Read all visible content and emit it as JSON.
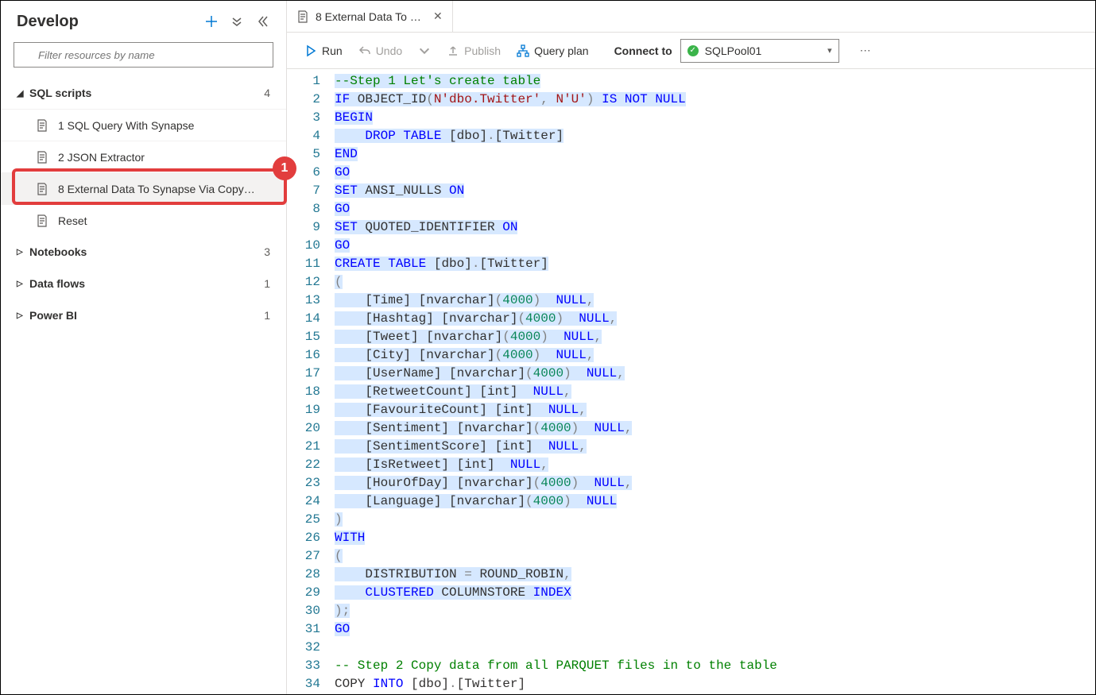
{
  "sidebar": {
    "title": "Develop",
    "filter_placeholder": "Filter resources by name",
    "groups": [
      {
        "key": "sql",
        "label": "SQL scripts",
        "expanded": true,
        "count": "4",
        "items": [
          {
            "label": "1 SQL Query With Synapse"
          },
          {
            "label": "2 JSON Extractor"
          },
          {
            "label": "8 External Data To Synapse Via Copy…",
            "active": true
          },
          {
            "label": "Reset"
          }
        ]
      },
      {
        "key": "notebooks",
        "label": "Notebooks",
        "expanded": false,
        "count": "3",
        "items": []
      },
      {
        "key": "dataflows",
        "label": "Data flows",
        "expanded": false,
        "count": "1",
        "items": []
      },
      {
        "key": "powerbi",
        "label": "Power BI",
        "expanded": false,
        "count": "1",
        "items": []
      }
    ]
  },
  "callout_badge": "1",
  "tab": {
    "label": "8 External Data To Sy…"
  },
  "toolbar": {
    "run": "Run",
    "undo": "Undo",
    "publish": "Publish",
    "queryplan": "Query plan",
    "connect_label": "Connect to",
    "connect_value": "SQLPool01"
  },
  "editor": {
    "lines": [
      {
        "n": 1,
        "sel": true,
        "tokens": [
          [
            "--Step 1 Let's create table",
            "comment"
          ]
        ]
      },
      {
        "n": 2,
        "sel": true,
        "tokens": [
          [
            "IF",
            "kw"
          ],
          [
            " OBJECT_ID",
            ""
          ],
          [
            "(",
            "gray"
          ],
          [
            "N'dbo.Twitter'",
            "str"
          ],
          [
            ",",
            "gray"
          ],
          [
            " ",
            ""
          ],
          [
            "N'U'",
            "str"
          ],
          [
            ")",
            "gray"
          ],
          [
            " ",
            ""
          ],
          [
            "IS",
            "kw"
          ],
          [
            " ",
            ""
          ],
          [
            "NOT",
            "kw"
          ],
          [
            " ",
            ""
          ],
          [
            "NULL",
            "kw"
          ]
        ]
      },
      {
        "n": 3,
        "sel": true,
        "tokens": [
          [
            "BEGIN",
            "kw"
          ]
        ]
      },
      {
        "n": 4,
        "sel": true,
        "tokens": [
          [
            "    ",
            ""
          ],
          [
            "DROP",
            "kw"
          ],
          [
            " ",
            ""
          ],
          [
            "TABLE",
            "kw"
          ],
          [
            " [dbo]",
            ""
          ],
          [
            ".",
            "gray"
          ],
          [
            "[Twitter]",
            ""
          ]
        ]
      },
      {
        "n": 5,
        "sel": true,
        "tokens": [
          [
            "END",
            "kw"
          ]
        ]
      },
      {
        "n": 6,
        "sel": true,
        "tokens": [
          [
            "GO",
            "kw"
          ]
        ]
      },
      {
        "n": 7,
        "sel": true,
        "tokens": [
          [
            "SET",
            "kw"
          ],
          [
            " ANSI_NULLS ",
            ""
          ],
          [
            "ON",
            "kw"
          ]
        ]
      },
      {
        "n": 8,
        "sel": true,
        "tokens": [
          [
            "GO",
            "kw"
          ]
        ]
      },
      {
        "n": 9,
        "sel": true,
        "tokens": [
          [
            "SET",
            "kw"
          ],
          [
            " QUOTED_IDENTIFIER ",
            ""
          ],
          [
            "ON",
            "kw"
          ]
        ]
      },
      {
        "n": 10,
        "sel": true,
        "tokens": [
          [
            "GO",
            "kw"
          ]
        ]
      },
      {
        "n": 11,
        "sel": true,
        "tokens": [
          [
            "CREATE",
            "kw"
          ],
          [
            " ",
            ""
          ],
          [
            "TABLE",
            "kw"
          ],
          [
            " [dbo]",
            ""
          ],
          [
            ".",
            "gray"
          ],
          [
            "[Twitter]",
            ""
          ]
        ]
      },
      {
        "n": 12,
        "sel": true,
        "tokens": [
          [
            "(",
            "gray"
          ]
        ]
      },
      {
        "n": 13,
        "sel": true,
        "tokens": [
          [
            "    [Time] [nvarchar]",
            ""
          ],
          [
            "(",
            "gray"
          ],
          [
            "4000",
            "num"
          ],
          [
            ")",
            "gray"
          ],
          [
            "  ",
            ""
          ],
          [
            "NULL",
            "kw"
          ],
          [
            ",",
            "gray"
          ]
        ]
      },
      {
        "n": 14,
        "sel": true,
        "tokens": [
          [
            "    [Hashtag] [nvarchar]",
            ""
          ],
          [
            "(",
            "gray"
          ],
          [
            "4000",
            "num"
          ],
          [
            ")",
            "gray"
          ],
          [
            "  ",
            ""
          ],
          [
            "NULL",
            "kw"
          ],
          [
            ",",
            "gray"
          ]
        ]
      },
      {
        "n": 15,
        "sel": true,
        "tokens": [
          [
            "    [Tweet] [nvarchar]",
            ""
          ],
          [
            "(",
            "gray"
          ],
          [
            "4000",
            "num"
          ],
          [
            ")",
            "gray"
          ],
          [
            "  ",
            ""
          ],
          [
            "NULL",
            "kw"
          ],
          [
            ",",
            "gray"
          ]
        ]
      },
      {
        "n": 16,
        "sel": true,
        "tokens": [
          [
            "    [City] [nvarchar]",
            ""
          ],
          [
            "(",
            "gray"
          ],
          [
            "4000",
            "num"
          ],
          [
            ")",
            "gray"
          ],
          [
            "  ",
            ""
          ],
          [
            "NULL",
            "kw"
          ],
          [
            ",",
            "gray"
          ]
        ]
      },
      {
        "n": 17,
        "sel": true,
        "tokens": [
          [
            "    [UserName] [nvarchar]",
            ""
          ],
          [
            "(",
            "gray"
          ],
          [
            "4000",
            "num"
          ],
          [
            ")",
            "gray"
          ],
          [
            "  ",
            ""
          ],
          [
            "NULL",
            "kw"
          ],
          [
            ",",
            "gray"
          ]
        ]
      },
      {
        "n": 18,
        "sel": true,
        "tokens": [
          [
            "    [RetweetCount] [int]  ",
            ""
          ],
          [
            "NULL",
            "kw"
          ],
          [
            ",",
            "gray"
          ]
        ]
      },
      {
        "n": 19,
        "sel": true,
        "tokens": [
          [
            "    [FavouriteCount] [int]  ",
            ""
          ],
          [
            "NULL",
            "kw"
          ],
          [
            ",",
            "gray"
          ]
        ]
      },
      {
        "n": 20,
        "sel": true,
        "tokens": [
          [
            "    [Sentiment] [nvarchar]",
            ""
          ],
          [
            "(",
            "gray"
          ],
          [
            "4000",
            "num"
          ],
          [
            ")",
            "gray"
          ],
          [
            "  ",
            ""
          ],
          [
            "NULL",
            "kw"
          ],
          [
            ",",
            "gray"
          ]
        ]
      },
      {
        "n": 21,
        "sel": true,
        "tokens": [
          [
            "    [SentimentScore] [int]  ",
            ""
          ],
          [
            "NULL",
            "kw"
          ],
          [
            ",",
            "gray"
          ]
        ]
      },
      {
        "n": 22,
        "sel": true,
        "tokens": [
          [
            "    [IsRetweet] [int]  ",
            ""
          ],
          [
            "NULL",
            "kw"
          ],
          [
            ",",
            "gray"
          ]
        ]
      },
      {
        "n": 23,
        "sel": true,
        "tokens": [
          [
            "    [HourOfDay] [nvarchar]",
            ""
          ],
          [
            "(",
            "gray"
          ],
          [
            "4000",
            "num"
          ],
          [
            ")",
            "gray"
          ],
          [
            "  ",
            ""
          ],
          [
            "NULL",
            "kw"
          ],
          [
            ",",
            "gray"
          ]
        ]
      },
      {
        "n": 24,
        "sel": true,
        "tokens": [
          [
            "    [Language] [nvarchar]",
            ""
          ],
          [
            "(",
            "gray"
          ],
          [
            "4000",
            "num"
          ],
          [
            ")",
            "gray"
          ],
          [
            "  ",
            ""
          ],
          [
            "NULL",
            "kw"
          ]
        ]
      },
      {
        "n": 25,
        "sel": true,
        "tokens": [
          [
            ")",
            "gray"
          ]
        ]
      },
      {
        "n": 26,
        "sel": true,
        "tokens": [
          [
            "WITH",
            "kw"
          ]
        ]
      },
      {
        "n": 27,
        "sel": true,
        "tokens": [
          [
            "(",
            "gray"
          ]
        ]
      },
      {
        "n": 28,
        "sel": true,
        "tokens": [
          [
            "    DISTRIBUTION ",
            ""
          ],
          [
            "=",
            "gray"
          ],
          [
            " ROUND_ROBIN",
            ""
          ],
          [
            ",",
            "gray"
          ]
        ]
      },
      {
        "n": 29,
        "sel": true,
        "tokens": [
          [
            "    ",
            ""
          ],
          [
            "CLUSTERED",
            "kw"
          ],
          [
            " COLUMNSTORE ",
            ""
          ],
          [
            "INDEX",
            "kw"
          ]
        ]
      },
      {
        "n": 30,
        "sel": true,
        "tokens": [
          [
            ")",
            "gray"
          ],
          [
            ";",
            "gray"
          ]
        ]
      },
      {
        "n": 31,
        "sel": true,
        "tokens": [
          [
            "GO",
            "kw"
          ]
        ]
      },
      {
        "n": 32,
        "sel": false,
        "tokens": [
          [
            "",
            ""
          ]
        ]
      },
      {
        "n": 33,
        "sel": false,
        "tokens": [
          [
            "-- Step 2 Copy data from all PARQUET files in to the table",
            "comment"
          ]
        ]
      },
      {
        "n": 34,
        "sel": false,
        "tokens": [
          [
            "COPY ",
            ""
          ],
          [
            "INTO",
            "kw"
          ],
          [
            " [dbo]",
            ""
          ],
          [
            ".",
            "gray"
          ],
          [
            "[Twitter]",
            ""
          ]
        ]
      }
    ]
  }
}
